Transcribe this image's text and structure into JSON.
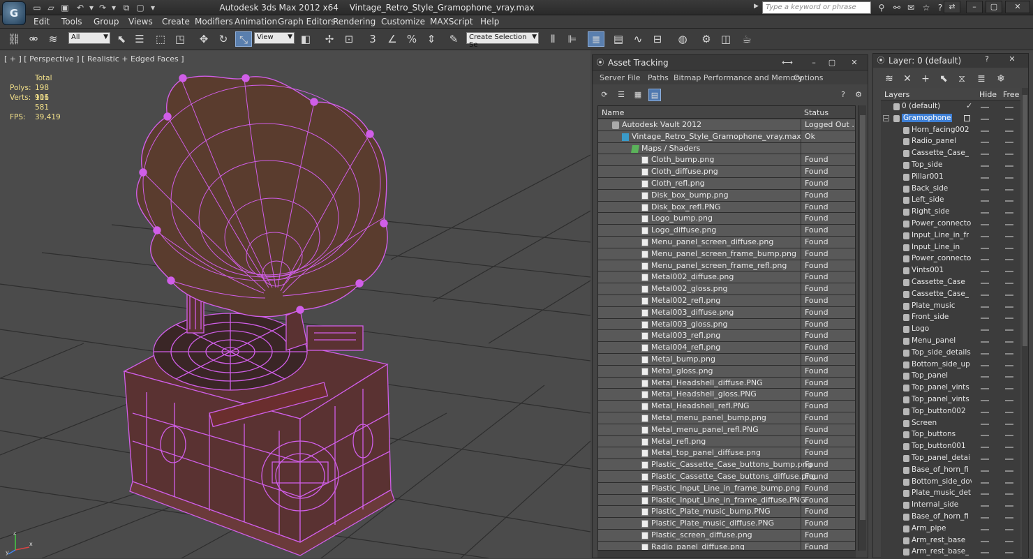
{
  "app": {
    "logo": "G",
    "title": "Autodesk 3ds Max  2012 x64",
    "file": "Vintage_Retro_Style_Gramophone_vray.max",
    "search_placeholder": "Type a keyword or phrase"
  },
  "menu": [
    "Edit",
    "Tools",
    "Group",
    "Views",
    "Create",
    "Modifiers",
    "Animation",
    "Graph Editors",
    "Rendering",
    "Customize",
    "MAXScript",
    "Help"
  ],
  "toolbar": {
    "filter_value": "All",
    "refcoord_value": "View",
    "selection_set_value": "Create Selection Se"
  },
  "viewport": {
    "label": "[ + ] [ Perspective ] [ Realistic + Edged Faces ]",
    "stats_total_label": "Total",
    "stats": [
      {
        "k": "Polys:",
        "v": "198 911"
      },
      {
        "k": "Verts:",
        "v": "106 581"
      }
    ],
    "fps_label": "FPS:",
    "fps_value": "39,419",
    "axis": {
      "x": "x",
      "y": "y",
      "z": "z"
    }
  },
  "asset_tracking": {
    "title": "Asset Tracking",
    "menu": [
      "Server",
      "File",
      "Paths",
      "Bitmap Performance and Memory",
      "Options"
    ],
    "columns": {
      "name": "Name",
      "status": "Status"
    },
    "rows": [
      {
        "name": "Autodesk Vault 2012",
        "status": "Logged Out ...",
        "indent": 0,
        "icon": "vault"
      },
      {
        "name": "Vintage_Retro_Style_Gramophone_vray.max",
        "status": "Ok",
        "indent": 1,
        "icon": "max"
      },
      {
        "name": "Maps / Shaders",
        "status": "",
        "indent": 2,
        "icon": "folder"
      },
      {
        "name": "Cloth_bump.png",
        "status": "Found",
        "indent": 3,
        "icon": "doc"
      },
      {
        "name": "Cloth_diffuse.png",
        "status": "Found",
        "indent": 3,
        "icon": "doc"
      },
      {
        "name": "Cloth_refl.png",
        "status": "Found",
        "indent": 3,
        "icon": "doc"
      },
      {
        "name": "Disk_box_bump.png",
        "status": "Found",
        "indent": 3,
        "icon": "doc"
      },
      {
        "name": "Disk_box_refl.PNG",
        "status": "Found",
        "indent": 3,
        "icon": "doc"
      },
      {
        "name": "Logo_bump.png",
        "status": "Found",
        "indent": 3,
        "icon": "doc"
      },
      {
        "name": "Logo_diffuse.png",
        "status": "Found",
        "indent": 3,
        "icon": "doc"
      },
      {
        "name": "Menu_panel_screen_diffuse.png",
        "status": "Found",
        "indent": 3,
        "icon": "doc"
      },
      {
        "name": "Menu_panel_screen_frame_bump.png",
        "status": "Found",
        "indent": 3,
        "icon": "doc"
      },
      {
        "name": "Menu_panel_screen_frame_refl.png",
        "status": "Found",
        "indent": 3,
        "icon": "doc"
      },
      {
        "name": "Metal002_diffuse.png",
        "status": "Found",
        "indent": 3,
        "icon": "doc"
      },
      {
        "name": "Metal002_gloss.png",
        "status": "Found",
        "indent": 3,
        "icon": "doc"
      },
      {
        "name": "Metal002_refl.png",
        "status": "Found",
        "indent": 3,
        "icon": "doc"
      },
      {
        "name": "Metal003_diffuse.png",
        "status": "Found",
        "indent": 3,
        "icon": "doc"
      },
      {
        "name": "Metal003_gloss.png",
        "status": "Found",
        "indent": 3,
        "icon": "doc"
      },
      {
        "name": "Metal003_refl.png",
        "status": "Found",
        "indent": 3,
        "icon": "doc"
      },
      {
        "name": "Metal004_refl.png",
        "status": "Found",
        "indent": 3,
        "icon": "doc"
      },
      {
        "name": "Metal_bump.png",
        "status": "Found",
        "indent": 3,
        "icon": "doc"
      },
      {
        "name": "Metal_gloss.png",
        "status": "Found",
        "indent": 3,
        "icon": "doc"
      },
      {
        "name": "Metal_Headshell_diffuse.PNG",
        "status": "Found",
        "indent": 3,
        "icon": "doc"
      },
      {
        "name": "Metal_Headshell_gloss.PNG",
        "status": "Found",
        "indent": 3,
        "icon": "doc"
      },
      {
        "name": "Metal_Headshell_refl.PNG",
        "status": "Found",
        "indent": 3,
        "icon": "doc"
      },
      {
        "name": "Metal_menu_panel_bump.png",
        "status": "Found",
        "indent": 3,
        "icon": "doc"
      },
      {
        "name": "Metal_menu_panel_refl.PNG",
        "status": "Found",
        "indent": 3,
        "icon": "doc"
      },
      {
        "name": "Metal_refl.png",
        "status": "Found",
        "indent": 3,
        "icon": "doc"
      },
      {
        "name": "Metal_top_panel_diffuse.png",
        "status": "Found",
        "indent": 3,
        "icon": "doc"
      },
      {
        "name": "Plastic_Cassette_Case_buttons_bump.png",
        "status": "Found",
        "indent": 3,
        "icon": "doc"
      },
      {
        "name": "Plastic_Cassette_Case_buttons_diffuse.png",
        "status": "Found",
        "indent": 3,
        "icon": "doc"
      },
      {
        "name": "Plastic_Input_Line_in_frame_bump.png",
        "status": "Found",
        "indent": 3,
        "icon": "doc"
      },
      {
        "name": "Plastic_Input_Line_in_frame_diffuse.PNG",
        "status": "Found",
        "indent": 3,
        "icon": "doc"
      },
      {
        "name": "Plastic_Plate_music_bump.PNG",
        "status": "Found",
        "indent": 3,
        "icon": "doc"
      },
      {
        "name": "Plastic_Plate_music_diffuse.PNG",
        "status": "Found",
        "indent": 3,
        "icon": "doc"
      },
      {
        "name": "Plastic_screen_diffuse.png",
        "status": "Found",
        "indent": 3,
        "icon": "doc"
      },
      {
        "name": "Radio_panel_diffuse.png",
        "status": "Found",
        "indent": 3,
        "icon": "doc"
      }
    ]
  },
  "layers": {
    "title": "Layer: 0 (default)",
    "columns": {
      "layers": "Layers",
      "hide": "Hide",
      "freeze": "Free"
    },
    "items": [
      {
        "name": "0 (default)",
        "level": 0,
        "checked": true
      },
      {
        "name": "Gramophone",
        "level": 0,
        "selected": true
      },
      {
        "name": "Horn_facing002",
        "level": 1
      },
      {
        "name": "Radio_panel",
        "level": 1
      },
      {
        "name": "Cassette_Case_",
        "level": 1
      },
      {
        "name": "Top_side",
        "level": 1
      },
      {
        "name": "Pillar001",
        "level": 1
      },
      {
        "name": "Back_side",
        "level": 1
      },
      {
        "name": "Left_side",
        "level": 1
      },
      {
        "name": "Right_side",
        "level": 1
      },
      {
        "name": "Power_connecto",
        "level": 1
      },
      {
        "name": "Input_Line_in_fr",
        "level": 1
      },
      {
        "name": "Input_Line_in",
        "level": 1
      },
      {
        "name": "Power_connecto",
        "level": 1
      },
      {
        "name": "Vints001",
        "level": 1
      },
      {
        "name": "Cassette_Case",
        "level": 1
      },
      {
        "name": "Cassette_Case_",
        "level": 1
      },
      {
        "name": "Plate_music",
        "level": 1
      },
      {
        "name": "Front_side",
        "level": 1
      },
      {
        "name": "Logo",
        "level": 1
      },
      {
        "name": "Menu_panel",
        "level": 1
      },
      {
        "name": "Top_side_details",
        "level": 1
      },
      {
        "name": "Bottom_side_up",
        "level": 1
      },
      {
        "name": "Top_panel",
        "level": 1
      },
      {
        "name": "Top_panel_vints",
        "level": 1
      },
      {
        "name": "Top_panel_vints",
        "level": 1
      },
      {
        "name": "Top_button002",
        "level": 1
      },
      {
        "name": "Screen",
        "level": 1
      },
      {
        "name": "Top_buttons",
        "level": 1
      },
      {
        "name": "Top_button001",
        "level": 1
      },
      {
        "name": "Top_panel_detai",
        "level": 1
      },
      {
        "name": "Base_of_horn_fi",
        "level": 1
      },
      {
        "name": "Bottom_side_dov",
        "level": 1
      },
      {
        "name": "Plate_music_det",
        "level": 1
      },
      {
        "name": "Internal_side",
        "level": 1
      },
      {
        "name": "Base_of_horn_fi",
        "level": 1
      },
      {
        "name": "Arm_pipe",
        "level": 1
      },
      {
        "name": "Arm_rest_base",
        "level": 1
      },
      {
        "name": "Arm_rest_base_",
        "level": 1
      }
    ]
  },
  "colors": {
    "wire": "#d05ee8",
    "horn_fill": "#5a3c2e",
    "body_fill": "#5a3232",
    "selection": "#3e7fd5"
  }
}
